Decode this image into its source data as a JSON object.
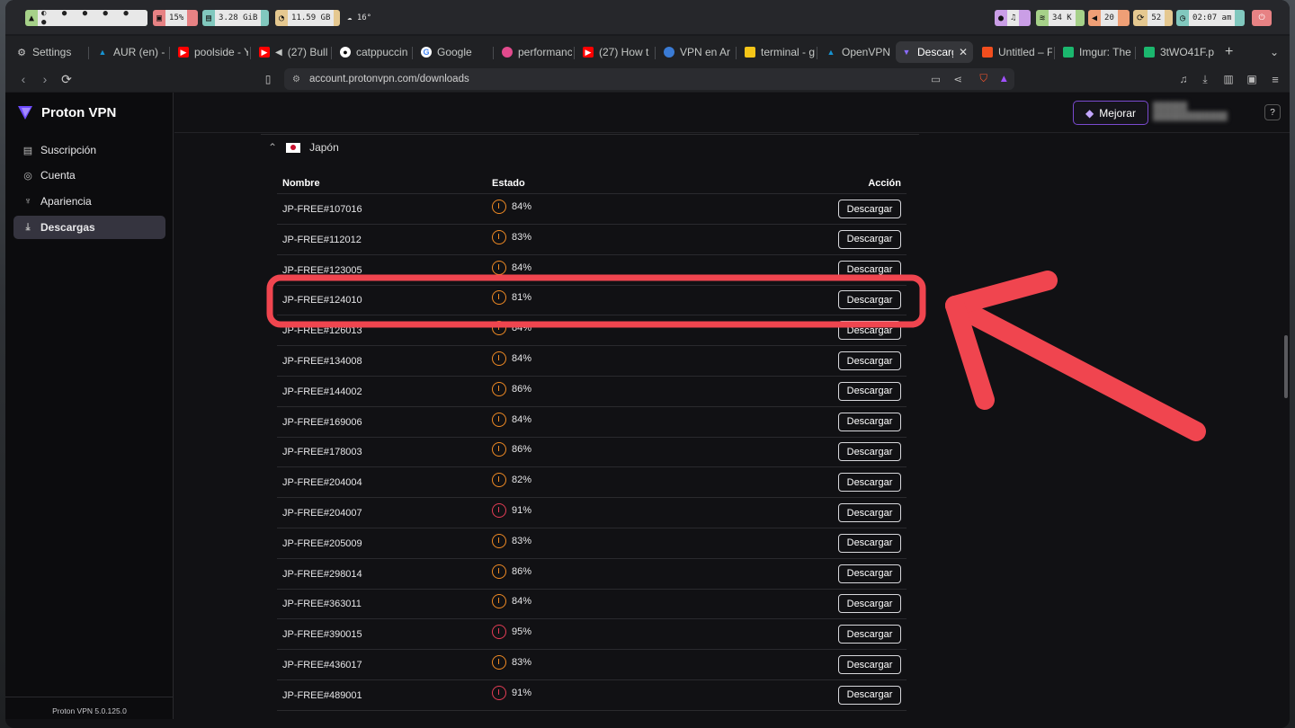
{
  "statusbar": {
    "cpu": "15%",
    "mem": "3.28 GiB",
    "disk": "11.59 GB",
    "weather": "16°",
    "net": "34 K",
    "volume": "20",
    "updates": "52",
    "time": "02:07 am"
  },
  "tabs": [
    {
      "label": "Settings",
      "icon": "gear-icon"
    },
    {
      "label": "AUR (en) -",
      "icon": "arch-icon"
    },
    {
      "label": "poolside - Y",
      "icon": "youtube-icon"
    },
    {
      "label": "(27) Bull",
      "icon": "youtube-icon"
    },
    {
      "label": "catppuccin",
      "icon": "github-icon"
    },
    {
      "label": "Google",
      "icon": "google-icon"
    },
    {
      "label": "performanc",
      "icon": "site-icon"
    },
    {
      "label": "(27) How t",
      "icon": "youtube-icon"
    },
    {
      "label": "VPN en Ar",
      "icon": "globe-icon"
    },
    {
      "label": "terminal - g",
      "icon": "folder-icon"
    },
    {
      "label": "OpenVPN",
      "icon": "arch-icon"
    },
    {
      "label": "Descarg",
      "icon": "proton-icon",
      "active": true
    },
    {
      "label": "Untitled – F",
      "icon": "figma-icon"
    },
    {
      "label": "Imgur: The",
      "icon": "imgur-icon"
    },
    {
      "label": "3tWO41F.p",
      "icon": "imgur-icon"
    }
  ],
  "address": {
    "url": "account.protonvpn.com/downloads"
  },
  "app": {
    "brand": "Proton VPN",
    "nav": [
      {
        "label": "Suscripción",
        "icon": "subscription-icon"
      },
      {
        "label": "Cuenta",
        "icon": "account-icon"
      },
      {
        "label": "Apariencia",
        "icon": "paint-icon"
      },
      {
        "label": "Descargas",
        "icon": "download-icon",
        "active": true
      }
    ],
    "version": "Proton VPN 5.0.125.0",
    "upgrade_label": "Mejorar",
    "help_label": "?"
  },
  "country": {
    "name": "Japón",
    "flag": "japan-flag"
  },
  "table": {
    "headers": {
      "name": "Nombre",
      "status": "Estado",
      "action": "Acción"
    },
    "button_label": "Descargar",
    "rows": [
      {
        "name": "JP-FREE#107016",
        "load": "84%",
        "level": "orange"
      },
      {
        "name": "JP-FREE#112012",
        "load": "83%",
        "level": "orange"
      },
      {
        "name": "JP-FREE#123005",
        "load": "84%",
        "level": "orange"
      },
      {
        "name": "JP-FREE#124010",
        "load": "81%",
        "level": "orange",
        "highlighted": true
      },
      {
        "name": "JP-FREE#126013",
        "load": "84%",
        "level": "orange"
      },
      {
        "name": "JP-FREE#134008",
        "load": "84%",
        "level": "orange"
      },
      {
        "name": "JP-FREE#144002",
        "load": "86%",
        "level": "orange"
      },
      {
        "name": "JP-FREE#169006",
        "load": "84%",
        "level": "orange"
      },
      {
        "name": "JP-FREE#178003",
        "load": "86%",
        "level": "orange"
      },
      {
        "name": "JP-FREE#204004",
        "load": "82%",
        "level": "orange"
      },
      {
        "name": "JP-FREE#204007",
        "load": "91%",
        "level": "red"
      },
      {
        "name": "JP-FREE#205009",
        "load": "83%",
        "level": "orange"
      },
      {
        "name": "JP-FREE#298014",
        "load": "86%",
        "level": "orange"
      },
      {
        "name": "JP-FREE#363011",
        "load": "84%",
        "level": "orange"
      },
      {
        "name": "JP-FREE#390015",
        "load": "95%",
        "level": "red"
      },
      {
        "name": "JP-FREE#436017",
        "load": "83%",
        "level": "orange"
      },
      {
        "name": "JP-FREE#489001",
        "load": "91%",
        "level": "red"
      }
    ]
  },
  "colors": {
    "accent": "#6d4aff",
    "load_orange": "#f08a24",
    "load_red": "#e43d55",
    "annotation_red": "#f0454f"
  }
}
